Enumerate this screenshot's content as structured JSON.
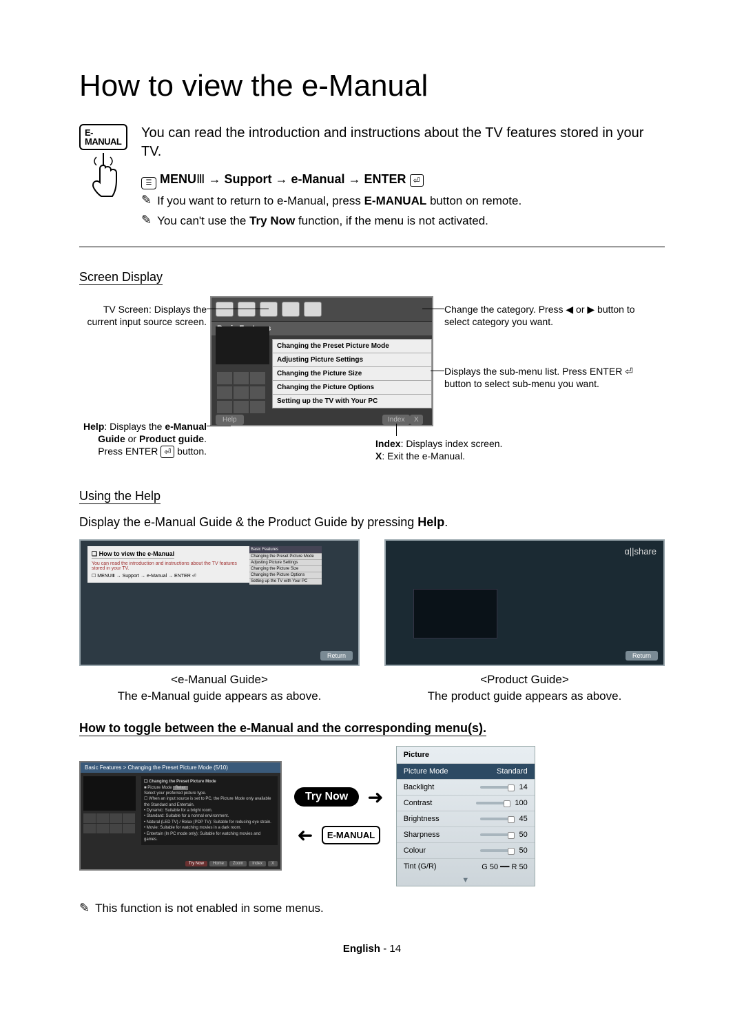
{
  "title": "How to view the e-Manual",
  "emanual_badge": "E-MANUAL",
  "intro": "You can read the introduction and instructions about the TV features stored in your TV.",
  "menu_path": {
    "prefix": "MENU",
    "glyph": "Ⅲ",
    "sep": " → ",
    "support": "Support",
    "emanual": "e-Manual",
    "enter": "ENTER",
    "enter_glyph": "⏎"
  },
  "notes": [
    {
      "pre": "If you want to return to e-Manual, press ",
      "b": "E-MANUAL",
      "post": " button on remote."
    },
    {
      "pre": "You can't use the ",
      "b": "Try Now",
      "post": " function, if the menu is not activated."
    }
  ],
  "screen_display_heading": "Screen Display",
  "emanual_screen": {
    "category_bar_label": "Basic Features",
    "submenu": [
      "Changing the Preset Picture Mode",
      "Adjusting Picture Settings",
      "Changing the Picture Size",
      "Changing the Picture Options",
      "Setting up the TV with Your PC"
    ],
    "help_btn": "Help",
    "index_btn": "Index",
    "x_btn": "X"
  },
  "callouts": {
    "tv_screen": "TV Screen: Displays the current input source screen.",
    "help": {
      "pre": "Help",
      "mid": ": Displays the ",
      "b1": "e-Manual Guide",
      "or": " or ",
      "b2": "Product guide",
      "post": ". Press ENTER",
      "glyph": "⏎",
      "post2": " button."
    },
    "change_category": "Change the category. Press ◀ or ▶ button to select category you want.",
    "submenu": "Displays the sub-menu list. Press ENTER ⏎ button to select sub-menu you want.",
    "index": {
      "b": "Index",
      "t": ": Displays index screen."
    },
    "x": {
      "b": "X",
      "t": ": Exit the e-Manual."
    }
  },
  "using_help_heading": "Using the Help",
  "using_help_desc": {
    "pre": "Display the e-Manual Guide & the Product Guide by pressing ",
    "b": "Help",
    "post": "."
  },
  "emanual_guide": {
    "title": "<e-Manual Guide>",
    "desc": "The e-Manual guide appears as above.",
    "panel_heading": "❏ How to view the e-Manual",
    "panel_text": "You can read the introduction and instructions about the TV features stored in your TV.",
    "panel_path": "☐ MENUⅢ → Support → e-Manual → ENTER ⏎",
    "panel_bar": "Basic Features",
    "panel_items": [
      "Changing the Preset Picture Mode",
      "Adjusting Picture Settings",
      "Changing the Picture Size",
      "Changing the Picture Options",
      "Setting up the TV with Your PC"
    ],
    "return_btn": "Return"
  },
  "product_guide": {
    "title": "<Product Guide>",
    "desc": "The product guide appears as above.",
    "logo": "ɑ||share",
    "return_btn": "Return"
  },
  "toggle_heading": "How to toggle between the e-Manual and the corresponding menu(s).",
  "toggle_mock": {
    "breadcrumb": "Basic Features > Changing the Preset Picture Mode (5/10)",
    "heading": "❏ Changing the Preset Picture Mode",
    "sub": "■ Picture Mode",
    "tag": "Relax",
    "text": "Select your preferred picture type.",
    "note": "☐ When an input source is set to PC, the Picture Mode only available the Standard and Entertain.",
    "bullets": [
      "Dynamic: Suitable for a bright room.",
      "Standard: Suitable for a normal environment.",
      "Natural (LED TV) / Relax (PDP TV): Suitable for reducing eye strain.",
      "Movie: Suitable for watching movies in a dark room.",
      "Entertain (In PC mode only): Suitable for watching movies and games."
    ],
    "buttons": [
      "Try Now",
      "Home",
      "Zoom",
      "Index",
      "X"
    ]
  },
  "trynow_badge": "Try Now",
  "picture_menu": {
    "header": "Picture",
    "rows": [
      {
        "label": "Picture Mode",
        "value": "Standard",
        "selected": true
      },
      {
        "label": "Backlight",
        "value": "14"
      },
      {
        "label": "Contrast",
        "value": "100"
      },
      {
        "label": "Brightness",
        "value": "45"
      },
      {
        "label": "Sharpness",
        "value": "50"
      },
      {
        "label": "Colour",
        "value": "50"
      },
      {
        "label": "Tint (G/R)",
        "value": "G 50 ━━ R 50",
        "noslider": true
      }
    ]
  },
  "footnote": "This function is not enabled in some menus.",
  "pagenum": {
    "lang": "English",
    "sep": " - ",
    "n": "14"
  }
}
